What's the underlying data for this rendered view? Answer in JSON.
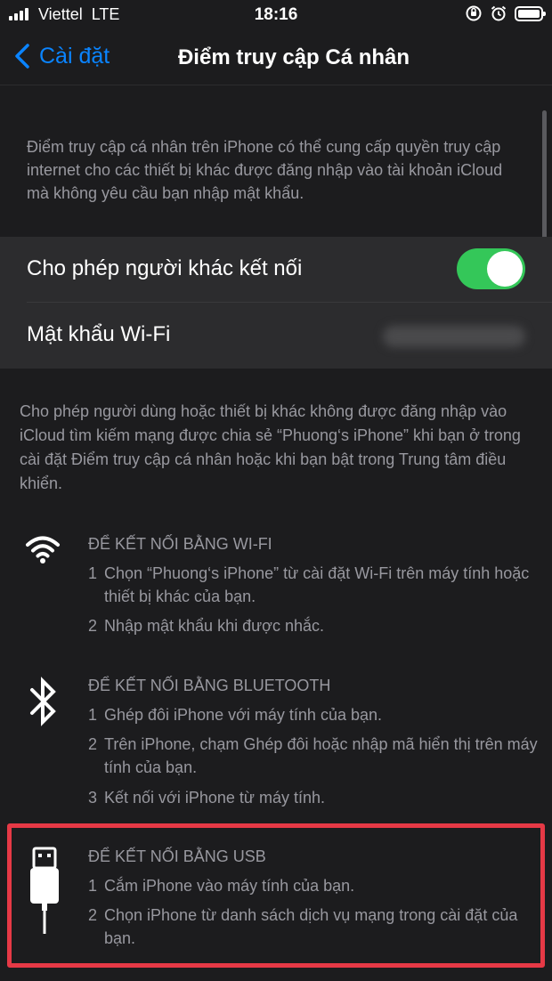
{
  "status_bar": {
    "carrier": "Viettel",
    "network": "LTE",
    "time": "18:16"
  },
  "nav": {
    "back_label": "Cài đặt",
    "title": "Điểm truy cập Cá nhân"
  },
  "intro": "Điểm truy cập cá nhân trên iPhone có thể cung cấp quyền truy cập internet cho các thiết bị khác được đăng nhập vào tài khoản iCloud mà không yêu cầu bạn nhập mật khẩu.",
  "settings": {
    "allow_others_label": "Cho phép người khác kết nối",
    "allow_others_on": true,
    "wifi_password_label": "Mật khẩu Wi-Fi"
  },
  "description": "Cho phép người dùng hoặc thiết bị khác không được đăng nhập vào iCloud tìm kiếm mạng được chia sẻ “Phuong‘s iPhone” khi bạn ở trong cài đặt Điểm truy cập cá nhân hoặc khi bạn bật trong Trung tâm điều khiển.",
  "sections": {
    "wifi": {
      "icon": "wifi-icon",
      "heading": "ĐỂ KẾT NỐI BẰNG WI-FI",
      "steps": [
        {
          "num": "1",
          "text": "Chọn “Phuong‘s iPhone” từ cài đặt Wi-Fi trên máy tính hoặc thiết bị khác của bạn."
        },
        {
          "num": "2",
          "text": "Nhập mật khẩu khi được nhắc."
        }
      ]
    },
    "bluetooth": {
      "icon": "bluetooth-icon",
      "heading": "ĐỂ KẾT NỐI BẰNG BLUETOOTH",
      "steps": [
        {
          "num": "1",
          "text": "Ghép đôi iPhone với máy tính của bạn."
        },
        {
          "num": "2",
          "text": "Trên iPhone, chạm Ghép đôi hoặc nhập mã hiển thị trên máy tính của bạn."
        },
        {
          "num": "3",
          "text": "Kết nối với iPhone từ máy tính."
        }
      ]
    },
    "usb": {
      "icon": "usb-cable-icon",
      "heading": "ĐỂ KẾT NỐI BẰNG USB",
      "steps": [
        {
          "num": "1",
          "text": "Cắm iPhone vào máy tính của bạn."
        },
        {
          "num": "2",
          "text": "Chọn iPhone từ danh sách dịch vụ mạng trong cài đặt của bạn."
        }
      ]
    }
  },
  "colors": {
    "accent": "#0a84ff",
    "toggle_on": "#34c759",
    "highlight": "#e63946",
    "background": "#1c1c1e",
    "group": "#2c2c2e",
    "secondary_text": "#98989f"
  }
}
